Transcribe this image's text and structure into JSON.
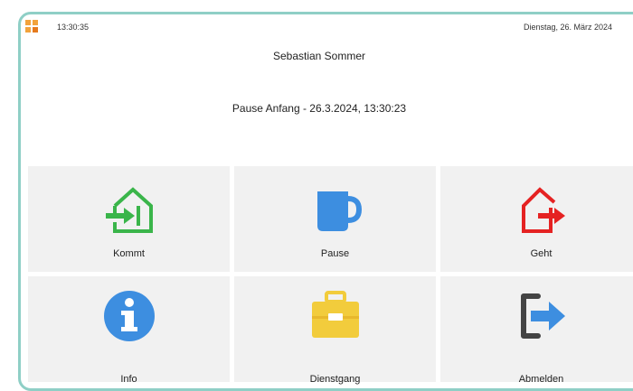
{
  "status": {
    "time": "13:30:35",
    "date": "Dienstag, 26. März 2024"
  },
  "user": {
    "name": "Sebastian Sommer"
  },
  "pause_status": "Pause Anfang - 26.3.2024, 13:30:23",
  "actions": [
    {
      "label": "Kommt",
      "icon": "house-arrow-in-icon",
      "color": "#3ab54a"
    },
    {
      "label": "Pause",
      "icon": "coffee-cup-icon",
      "color": "#3d8ee0"
    },
    {
      "label": "Geht",
      "icon": "house-arrow-out-icon",
      "color": "#e52222"
    },
    {
      "label": "Info",
      "icon": "info-icon",
      "color": "#3d8ee0"
    },
    {
      "label": "Dienstgang",
      "icon": "briefcase-icon",
      "color": "#f2cc3c"
    },
    {
      "label": "Abmelden",
      "icon": "logout-icon",
      "color": "#3d8ee0"
    }
  ],
  "colors": {
    "frame": "#8fcfc6",
    "tile": "#f1f1f1",
    "app_icon": "#f2a33c"
  }
}
